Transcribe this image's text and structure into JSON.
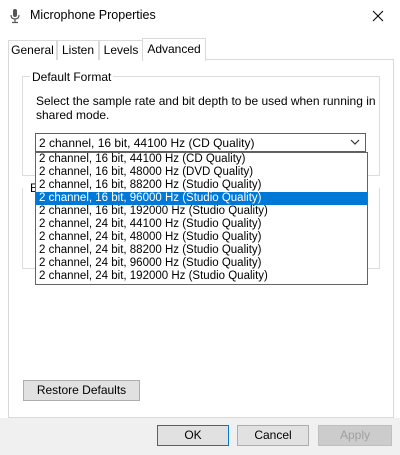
{
  "window": {
    "title": "Microphone Properties"
  },
  "tabs": [
    {
      "label": "General"
    },
    {
      "label": "Listen"
    },
    {
      "label": "Levels"
    },
    {
      "label": "Advanced"
    }
  ],
  "default_format": {
    "legend": "Default Format",
    "description": "Select the sample rate and bit depth to be used when running in shared mode.",
    "selected": "2 channel, 16 bit, 44100 Hz (CD Quality)",
    "options": [
      "2 channel, 16 bit, 44100 Hz (CD Quality)",
      "2 channel, 16 bit, 48000 Hz (DVD Quality)",
      "2 channel, 16 bit, 88200 Hz (Studio Quality)",
      "2 channel, 16 bit, 96000 Hz (Studio Quality)",
      "2 channel, 16 bit, 192000 Hz (Studio Quality)",
      "2 channel, 24 bit, 44100 Hz (Studio Quality)",
      "2 channel, 24 bit, 48000 Hz (Studio Quality)",
      "2 channel, 24 bit, 88200 Hz (Studio Quality)",
      "2 channel, 24 bit, 96000 Hz (Studio Quality)",
      "2 channel, 24 bit, 192000 Hz (Studio Quality)"
    ],
    "highlighted_index": 3
  },
  "exclusive_group_fragment": "E",
  "buttons": {
    "restore": "Restore Defaults",
    "ok": "OK",
    "cancel": "Cancel",
    "apply": "Apply"
  },
  "colors": {
    "accent": "#0078d7"
  }
}
